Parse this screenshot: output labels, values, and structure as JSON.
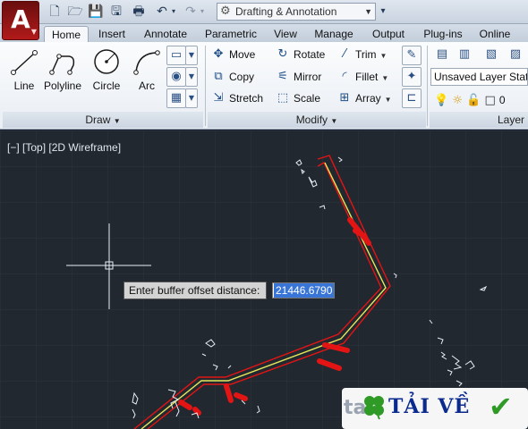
{
  "app": {
    "logo_letter": "A",
    "workspace": "Drafting & Annotation"
  },
  "quick_access": [
    "new-icon",
    "open-icon",
    "save-icon",
    "save-as-icon",
    "plot-icon",
    "undo-icon",
    "redo-icon"
  ],
  "tabs": [
    {
      "label": "Home",
      "active": true
    },
    {
      "label": "Insert"
    },
    {
      "label": "Annotate"
    },
    {
      "label": "Parametric"
    },
    {
      "label": "View"
    },
    {
      "label": "Manage"
    },
    {
      "label": "Output"
    },
    {
      "label": "Plug-ins"
    },
    {
      "label": "Online"
    }
  ],
  "draw_panel": {
    "title": "Draw",
    "tools": [
      "Line",
      "Polyline",
      "Circle",
      "Arc"
    ]
  },
  "modify_panel": {
    "title": "Modify",
    "tools": [
      "Move",
      "Rotate",
      "Trim",
      "Copy",
      "Mirror",
      "Fillet",
      "Stretch",
      "Scale",
      "Array"
    ]
  },
  "layers_panel": {
    "title": "Layer",
    "layer_state": "Unsaved Layer State",
    "current_layer": "0"
  },
  "viewport": {
    "label": "[−] [Top] [2D Wireframe]"
  },
  "command": {
    "prompt": "Enter buffer offset distance:",
    "value": "21446.6790"
  },
  "watermark": {
    "text": "TẢI VỀ",
    "prefix": "ta"
  },
  "colors": {
    "canvas_bg": "#212830",
    "path_outline": "#e31414",
    "centerline": "#e8e85a",
    "accent": "#b21a1a"
  }
}
